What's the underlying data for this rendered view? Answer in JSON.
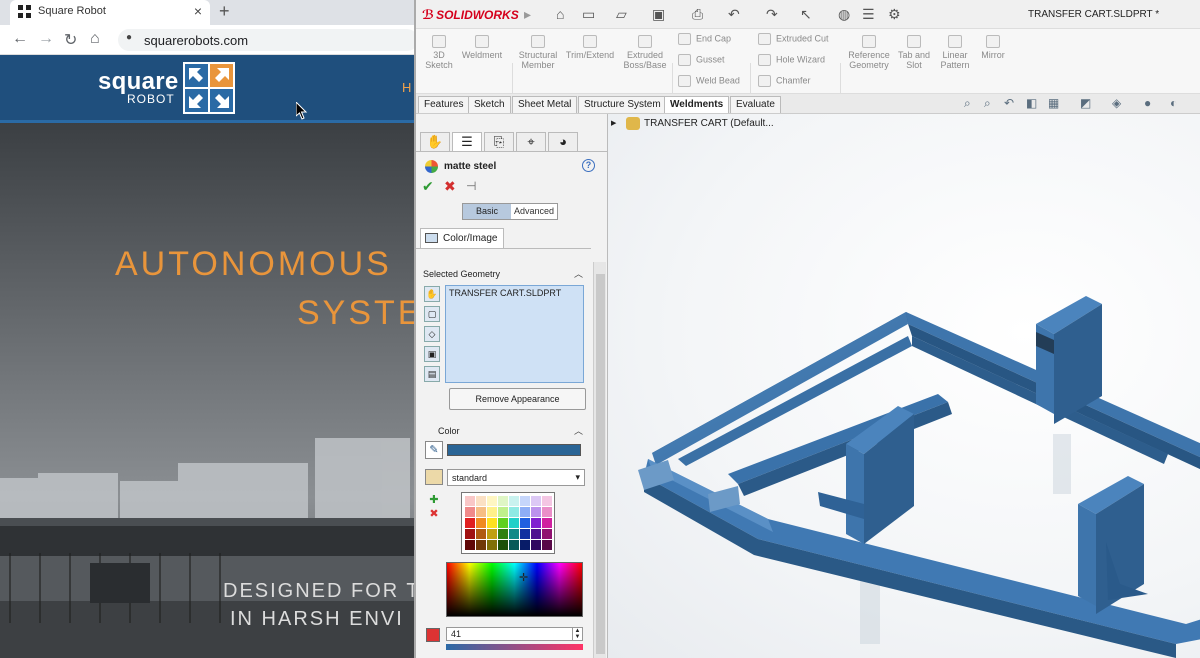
{
  "browser": {
    "tab_title": "Square Robot",
    "tab_close": "×",
    "new_tab": "+",
    "url": "squarerobots.com",
    "back": "←",
    "forward": "→",
    "reload": "↻",
    "home": "⌂",
    "lock": "🔒"
  },
  "site": {
    "logo_word1": "square",
    "logo_word2": "ROBOT",
    "nav_partial": "H",
    "hero_line1": "AUTONOMOUS",
    "hero_line2": "SYSTE",
    "hero_sub1": "DESIGNED FOR T",
    "hero_sub2": "IN HARSH ENVI",
    "accent_color": "#e9953b",
    "header_color": "#1f4f7d"
  },
  "solidworks": {
    "app_name": "SOLIDWORKS",
    "doc_title": "TRANSFER CART.SLDPRT *",
    "commands_left": [
      {
        "label": "3D\nSketch"
      },
      {
        "label": "Weldment"
      },
      {
        "label": "Structural\nMember"
      },
      {
        "label": "Trim/Extend"
      },
      {
        "label": "Extruded\nBoss/Base"
      }
    ],
    "commands_col1": [
      "End Cap",
      "Gusset",
      "Weld Bead"
    ],
    "commands_col2": [
      "Extruded Cut",
      "Hole Wizard",
      "Chamfer"
    ],
    "commands_right": [
      {
        "label": "Reference\nGeometry"
      },
      {
        "label": "Tab and\nSlot"
      },
      {
        "label": "Linear\nPattern"
      },
      {
        "label": "Mirror"
      }
    ],
    "tabs": [
      "Features",
      "Sketch",
      "Sheet Metal",
      "Structure System",
      "Weldments",
      "Evaluate"
    ],
    "active_tab": "Weldments",
    "property_manager": {
      "title": "matte steel",
      "help": "?",
      "ok": "✔",
      "cancel": "✖",
      "pin": "⊣",
      "basic": "Basic",
      "advanced": "Advanced",
      "color_image_tab": "Color/Image",
      "selected_geometry_label": "Selected Geometry",
      "selected_item": "TRANSFER CART.SLDPRT",
      "remove_button": "Remove Appearance",
      "color_label": "Color",
      "palette": "standard",
      "value": "41",
      "current_color": "#2a6596"
    },
    "feature_tree": {
      "root": "TRANSFER CART  (Default..."
    },
    "model_color": "#3a70a8"
  }
}
